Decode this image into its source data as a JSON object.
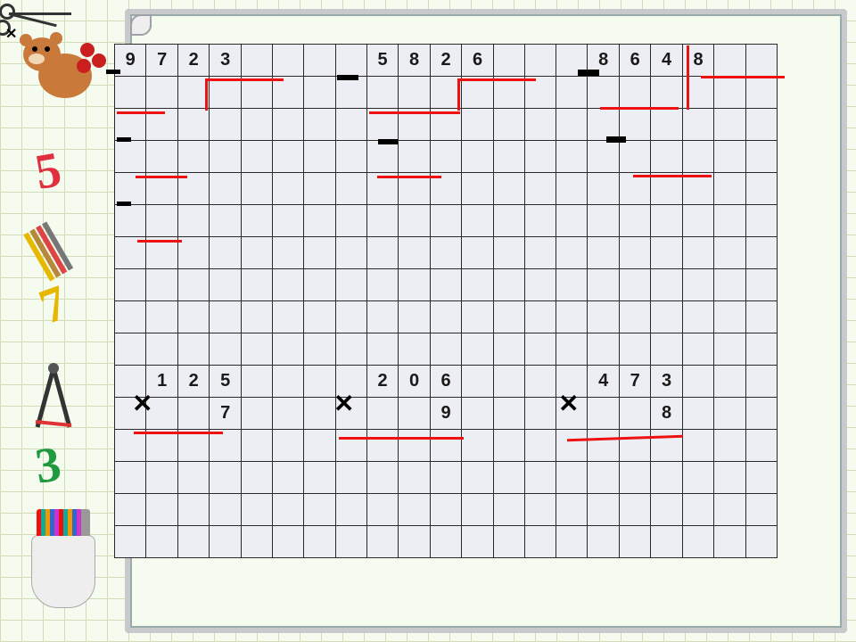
{
  "division": {
    "p1": {
      "d0": "9",
      "d1": "7",
      "d2": "2",
      "d3": "3"
    },
    "p2": {
      "d0": "5",
      "d1": "8",
      "d2": "2",
      "d3": "6"
    },
    "p3": {
      "d0": "8",
      "d1": "6",
      "d2": "4",
      "d3": "8"
    }
  },
  "multiplication": {
    "p1": {
      "a0": "1",
      "a1": "2",
      "a2": "5",
      "b": "7"
    },
    "p2": {
      "a0": "2",
      "a1": "0",
      "a2": "6",
      "b": "9"
    },
    "p3": {
      "a0": "4",
      "a1": "7",
      "a2": "3",
      "b": "8"
    }
  },
  "sidebar": {
    "n5": "5",
    "n7": "7",
    "n3": "3"
  },
  "symbols": {
    "times": "✕"
  }
}
